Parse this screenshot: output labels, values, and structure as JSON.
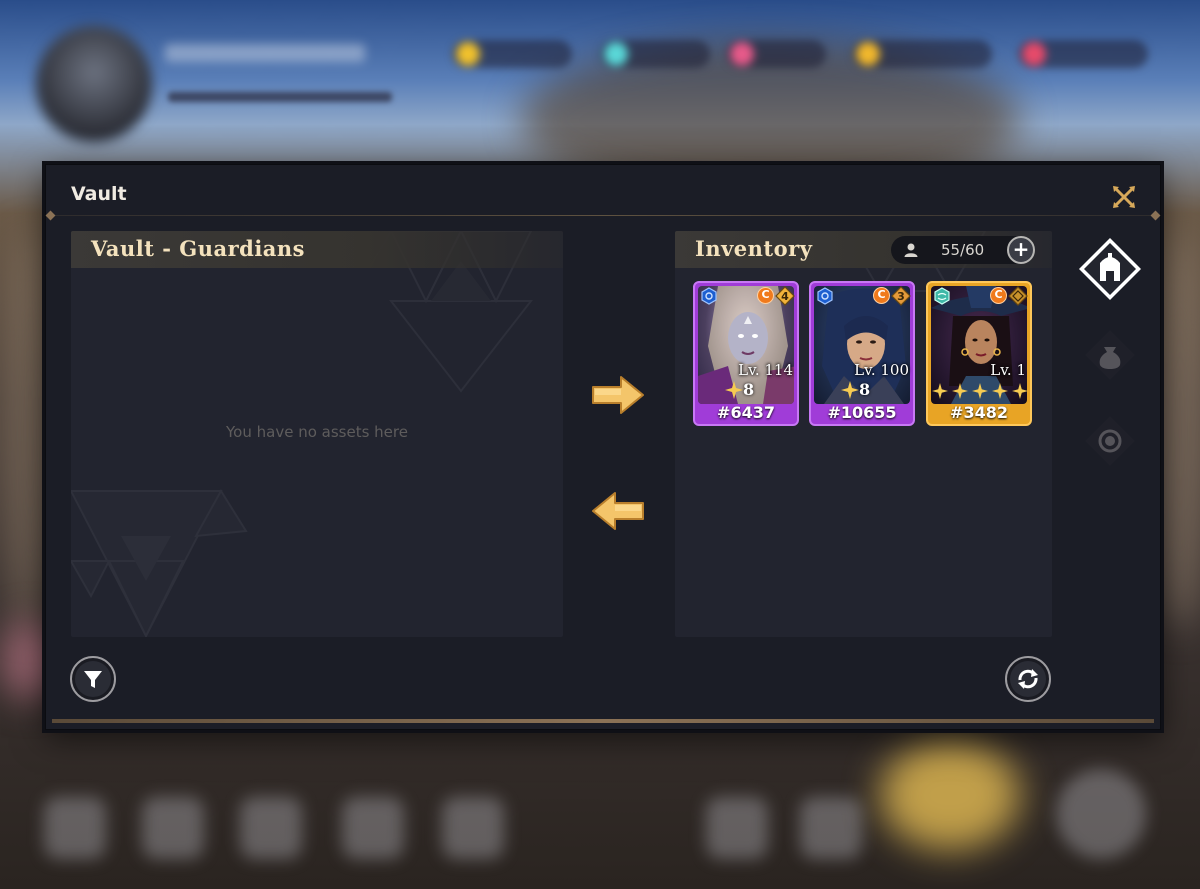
{
  "window": {
    "title": "Vault"
  },
  "left_panel": {
    "title": "Vault - Guardians",
    "empty_message": "You have no assets here"
  },
  "right_panel": {
    "title": "Inventory",
    "capacity": "55/60",
    "add_label": "+"
  },
  "transfer": {
    "to_inventory_icon": "arrow-right-icon",
    "to_vault_icon": "arrow-left-icon"
  },
  "cards": [
    {
      "id": "#6437",
      "level": "Lv. 114",
      "rank": "8",
      "element_icon": "water-element-icon",
      "class_badge": "C",
      "tier": "4",
      "frame": "purple",
      "frame_color": "#a03cd8"
    },
    {
      "id": "#10655",
      "level": "Lv. 100",
      "rank": "8",
      "element_icon": "water-element-icon",
      "class_badge": "C",
      "tier": "3",
      "frame": "purple",
      "frame_color": "#a03cd8"
    },
    {
      "id": "#3482",
      "level": "Lv. 1",
      "stars": 5,
      "element_icon": "wind-element-icon",
      "class_badge": "C",
      "tier": "",
      "frame": "gold",
      "frame_color": "#e8a425"
    }
  ],
  "side_tabs": [
    {
      "name": "guardians-tab",
      "icon": "helmet-icon",
      "active": true
    },
    {
      "name": "items-tab",
      "icon": "money-bag-icon",
      "active": false
    },
    {
      "name": "pets-tab",
      "icon": "circle-emblem-icon",
      "active": false
    }
  ],
  "footer": {
    "filter_icon": "filter-icon",
    "refresh_icon": "refresh-icon"
  },
  "colors": {
    "accent_gold": "#f4c56a",
    "panel_bg": "#22242f",
    "window_bg": "#1b1d26"
  }
}
